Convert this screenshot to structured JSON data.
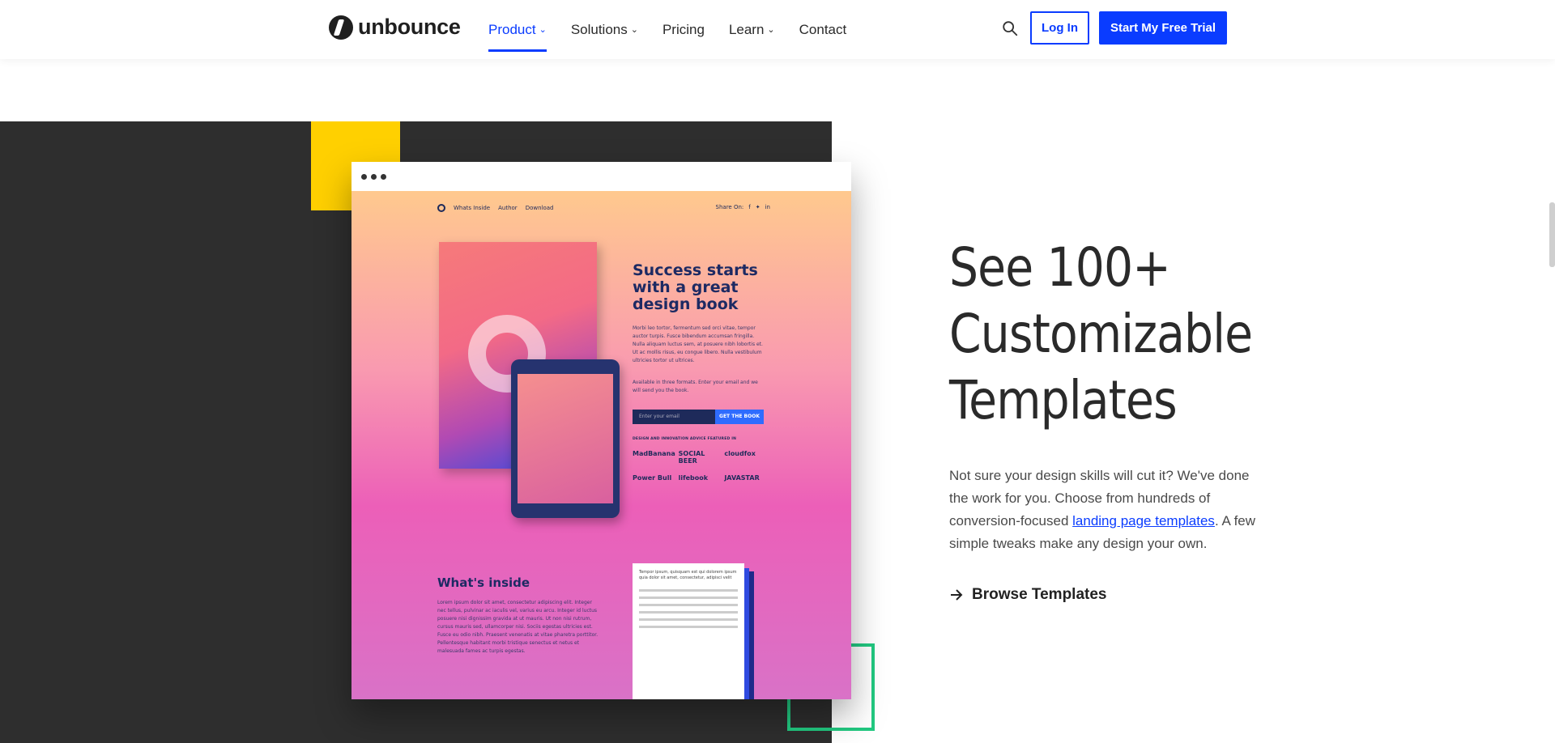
{
  "header": {
    "logo_text": "unbounce",
    "nav": [
      {
        "label": "Product",
        "has_dropdown": true,
        "active": true
      },
      {
        "label": "Solutions",
        "has_dropdown": true
      },
      {
        "label": "Pricing",
        "has_dropdown": false
      },
      {
        "label": "Learn",
        "has_dropdown": true
      },
      {
        "label": "Contact",
        "has_dropdown": false
      }
    ],
    "search_icon": "search-icon",
    "login_label": "Log In",
    "trial_label": "Start My Free Trial"
  },
  "colors": {
    "brand_blue": "#0a3cff",
    "accent_yellow": "#ffd000",
    "accent_green": "#22c981",
    "dark_panel": "#2e2e2e"
  },
  "preview": {
    "nav": [
      "Whats Inside",
      "Author",
      "Download"
    ],
    "share_label": "Share On:",
    "headline": "Success starts with a great design book",
    "paragraph": "Morbi leo tortor, fermentum sed orci vitae, tempor auctor turpis. Fusce bibendum accumsan fringilla. Nulla aliquam luctus sem, at posuere nibh lobortis et. Ut ac mollis risus, eu congue libero. Nulla vestibulum ultricies tortor ut ultrices.",
    "paragraph2": "Available in three formats. Enter your email and we will send you the book.",
    "email_placeholder": "Enter your email",
    "cta_label": "GET THE BOOK",
    "featured_label": "DESIGN AND INNOVATION ADVICE FEATURED IN",
    "logos": [
      "MadBanana",
      "SOCIAL BEER",
      "cloudfox",
      "Power Bull",
      "lifebook",
      "JAVASTAR"
    ],
    "inside_title": "What's inside",
    "inside_text": "Lorem ipsum dolor sit amet, consectetur adipiscing elit. Integer nec tellus, pulvinar ac iaculis vel, varius eu arcu. Integer id luctus posuere nisi dignissim gravida at ut mauris. Ut non nisi rutrum, cursus mauris sed, ullamcorper nisi. Sociis egestas ultricies est. Fusce eu odio nibh. Praesent venenatis at vitae pharetra porttitor. Pellentesque habitant morbi tristique senectus et netus et malesuada fames ac turpis egestas.",
    "doc_title": "Tempor ipsum, quisquam est qui dolorem ipsum quia dolor sit amet, consectetur, adipisci velit"
  },
  "hero": {
    "title": "See 100+ Customizable Templates",
    "desc_before": "Not sure your design skills will cut it? We've done the work for you. Choose from hundreds of conversion-focused ",
    "desc_link": "landing page templates",
    "desc_after": ". A few simple tweaks make any design your own.",
    "browse_label": "Browse Templates",
    "browse_icon": "arrow-right-icon"
  }
}
